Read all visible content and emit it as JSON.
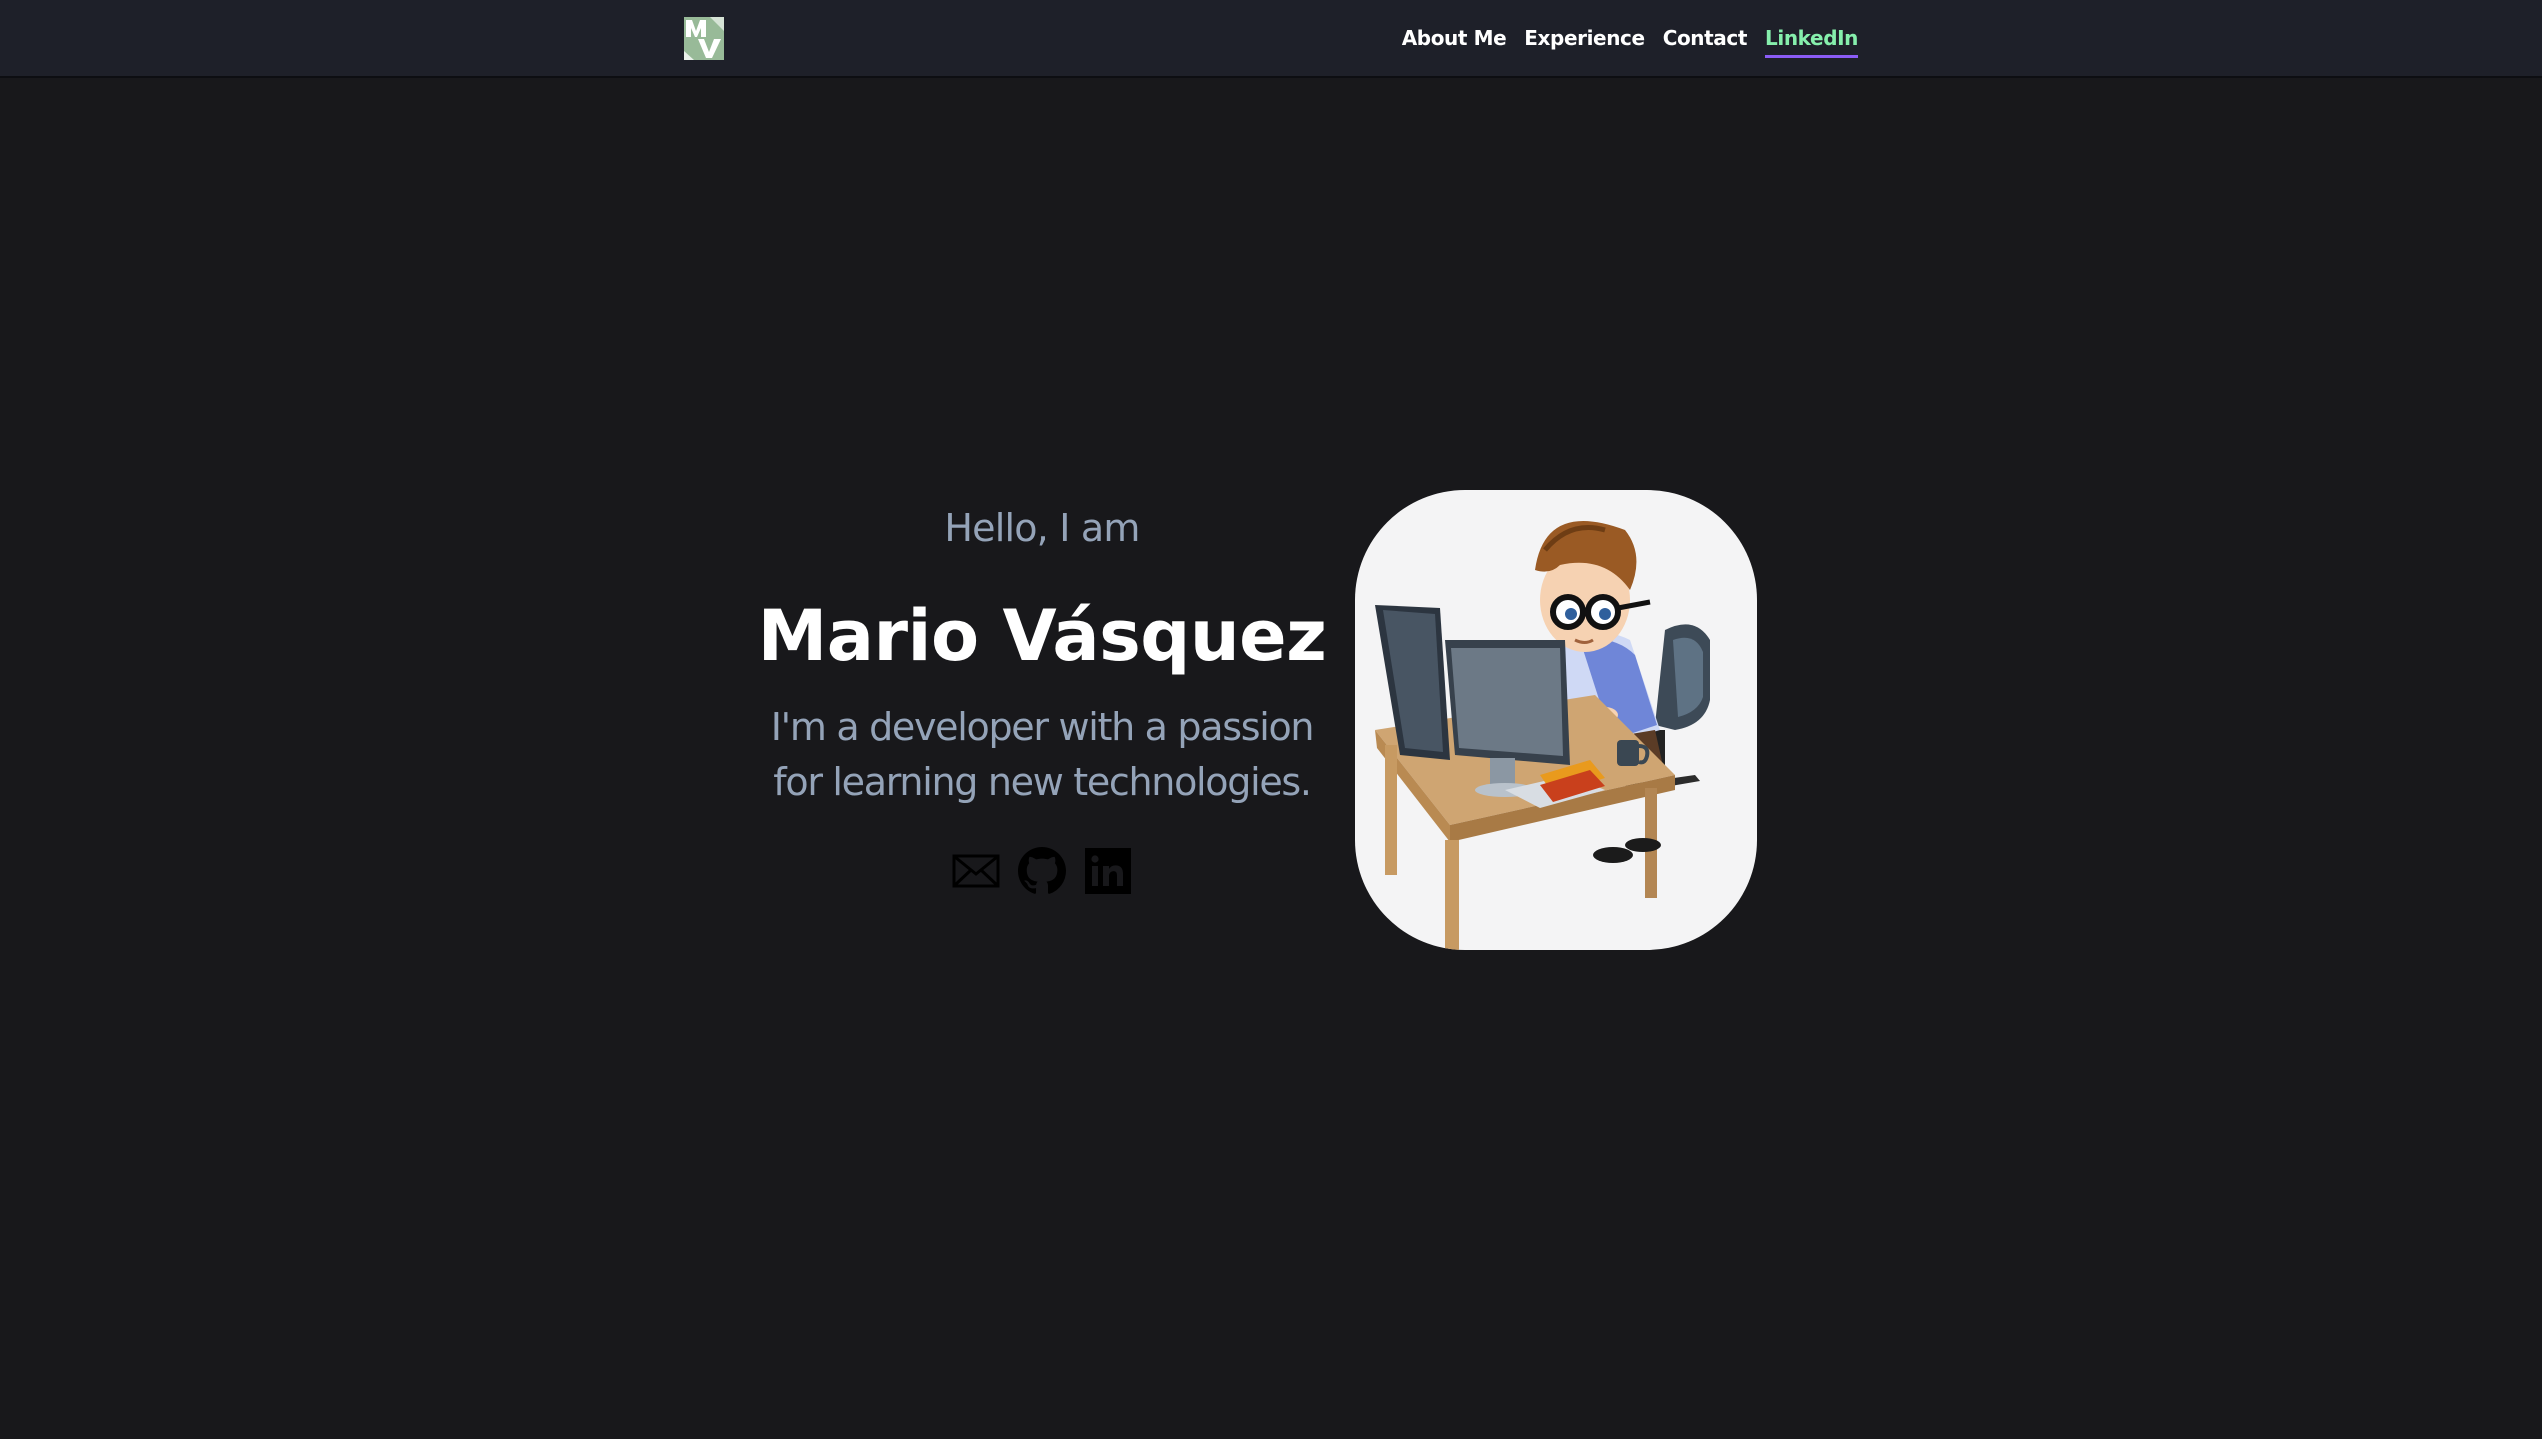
{
  "navbar": {
    "logo_alt": "MV",
    "links": [
      {
        "label": "About Me"
      },
      {
        "label": "Experience"
      },
      {
        "label": "Contact"
      },
      {
        "label": "LinkedIn",
        "active": true
      }
    ]
  },
  "hero": {
    "greeting": "Hello, I am",
    "name": "Mario Vásquez",
    "tagline_line1": "I'm a developer with a passion",
    "tagline_line2": "for learning new technologies.",
    "socials": [
      {
        "icon": "email-icon"
      },
      {
        "icon": "github-icon"
      },
      {
        "icon": "linkedin-icon"
      }
    ],
    "avatar_alt": "Cartoon developer working at a computer desk"
  },
  "colors": {
    "background": "#18181b",
    "navbar": "#1e2029",
    "accent_text": "#86efac",
    "accent_underline": "#8b5cf6",
    "muted_text": "#94a3b8"
  }
}
